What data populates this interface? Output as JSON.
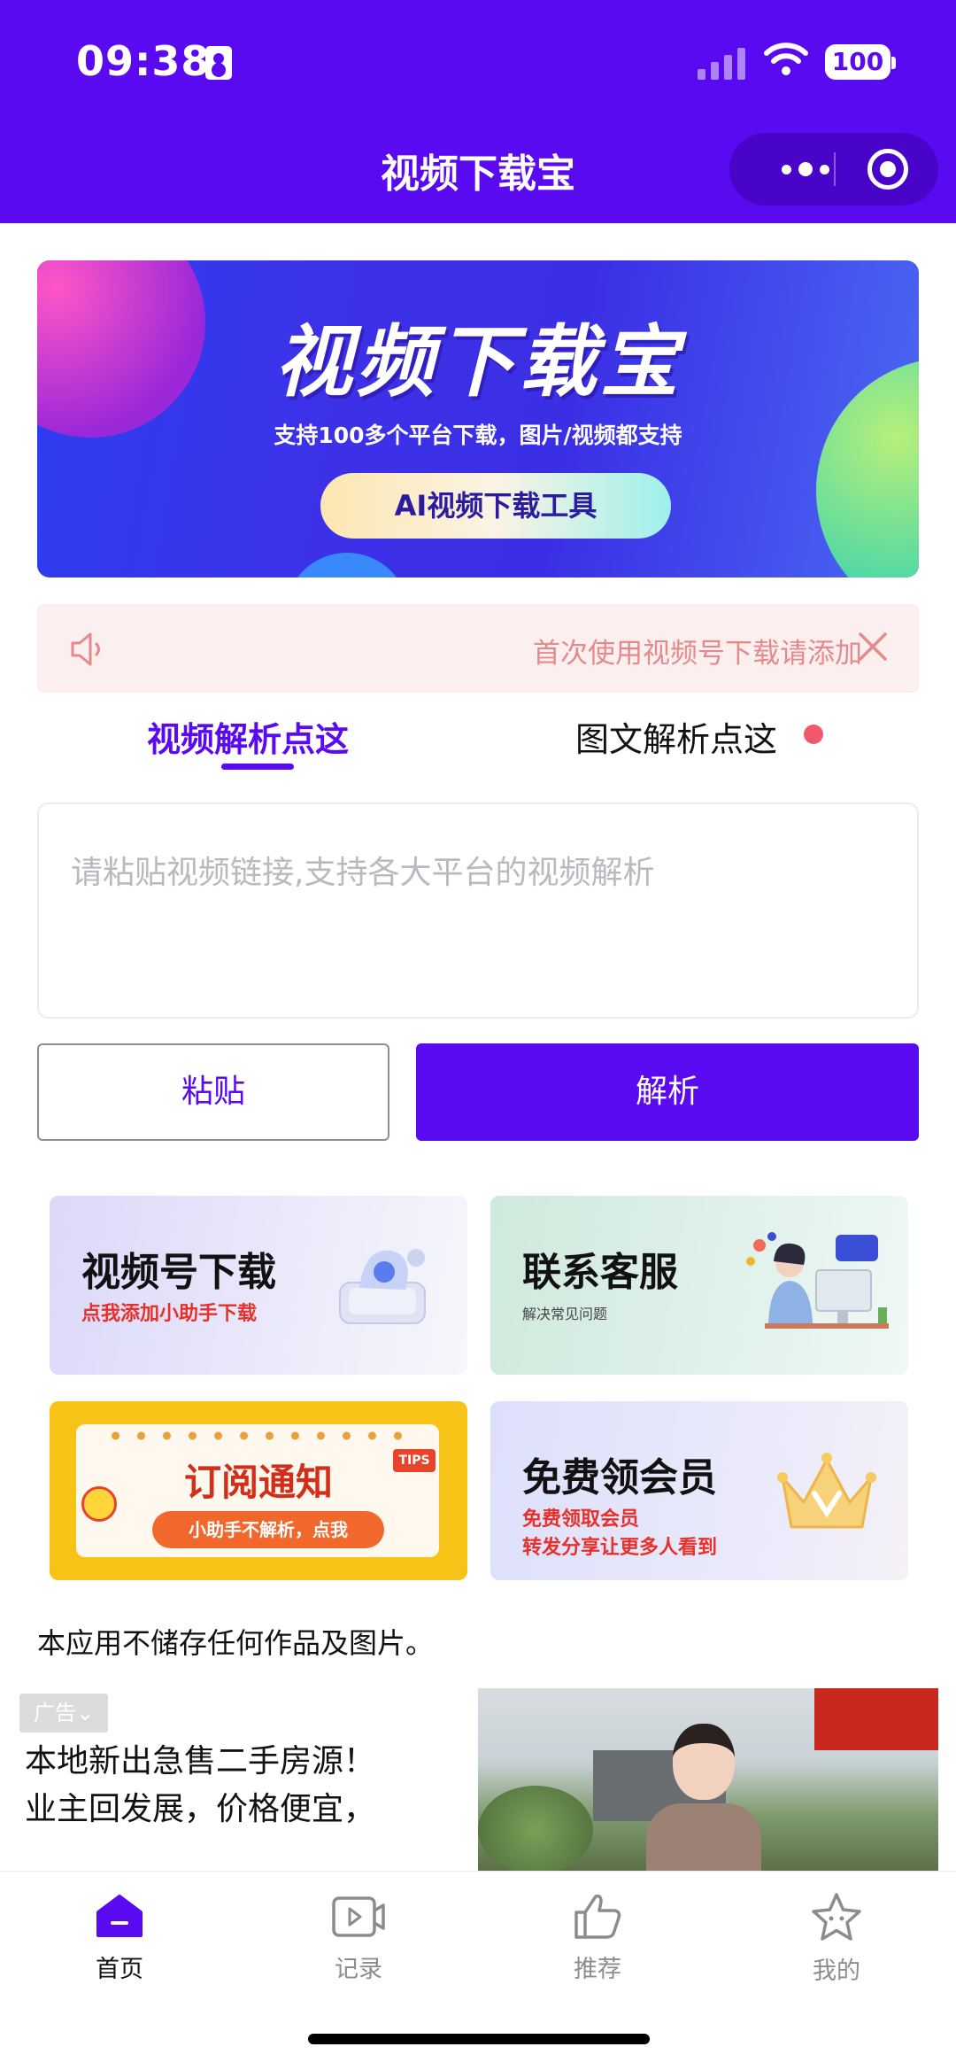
{
  "status_bar": {
    "time": "09:38",
    "battery": "100"
  },
  "header": {
    "title": "视频下载宝"
  },
  "banner": {
    "title": "视频下载宝",
    "subtitle": "支持100多个平台下载，图片/视频都支持",
    "button": "AI视频下载工具"
  },
  "notice": {
    "text": "首次使用视频号下载请添加"
  },
  "tabs": {
    "video": "视频解析点这",
    "image": "图文解析点这"
  },
  "input": {
    "placeholder": "请粘贴视频链接,支持各大平台的视频解析",
    "value": ""
  },
  "buttons": {
    "paste": "粘贴",
    "parse": "解析"
  },
  "cards": [
    {
      "title": "视频号下载",
      "subtitle": "点我添加小助手下载"
    },
    {
      "title": "联系客服",
      "subtitle": "解决常见问题"
    },
    {
      "title": "订阅通知",
      "subtitle": "小助手不解析，点我",
      "tag": "TIPS"
    },
    {
      "title": "免费领会员",
      "subtitle_line1": "免费领取会员",
      "subtitle_line2": "转发分享让更多人看到"
    }
  ],
  "disclaimer": "本应用不储存任何作品及图片。",
  "ad": {
    "badge": "广告",
    "line1": "本地新出急售二手房源！",
    "line2": "业主回发展，价格便宜，"
  },
  "tabbar": [
    {
      "label": "首页",
      "icon": "home-icon",
      "active": true
    },
    {
      "label": "记录",
      "icon": "video-record-icon",
      "active": false
    },
    {
      "label": "推荐",
      "icon": "thumbs-up-icon",
      "active": false
    },
    {
      "label": "我的",
      "icon": "star-face-icon",
      "active": false
    }
  ],
  "colors": {
    "primary": "#5a0af0",
    "notice_text": "#e58a8a",
    "dot": "#f0596a"
  }
}
